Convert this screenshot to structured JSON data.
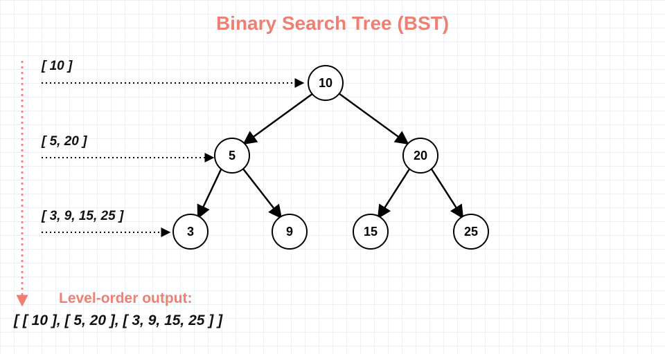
{
  "title": "Binary Search Tree (BST)",
  "nodes": {
    "root": "10",
    "l": "5",
    "r": "20",
    "ll": "3",
    "lr": "9",
    "rl": "15",
    "rr": "25"
  },
  "level_labels": {
    "l0": "[ 10 ]",
    "l1": "[ 5, 20 ]",
    "l2": "[ 3, 9, 15, 25 ]"
  },
  "output_title": "Level-order output:",
  "output_text": "[ [ 10 ], [ 5, 20 ], [ 3, 9, 15, 25 ] ]"
}
